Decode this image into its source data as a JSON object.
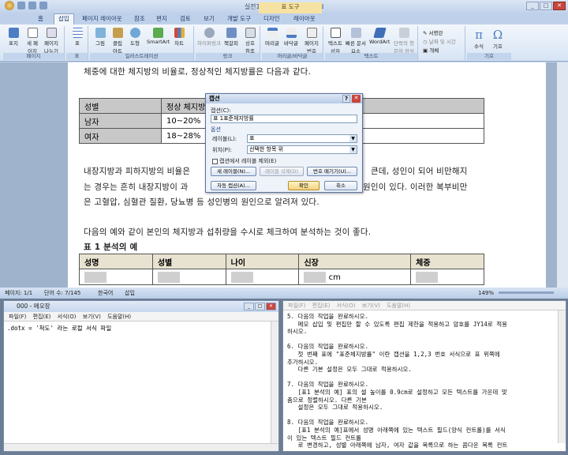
{
  "word": {
    "title": "실전1-06 - Microsoft Word",
    "context_tab_header": "표 도구",
    "tabs": [
      "홈",
      "삽입",
      "페이지 레이아웃",
      "참조",
      "편지",
      "검토",
      "보기",
      "개발 도구",
      "디자인",
      "레이아웃"
    ],
    "active_tab": "삽입",
    "groups": [
      {
        "label": "페이지",
        "buttons": [
          "표지",
          "새 페이지",
          "페이지 나누기"
        ]
      },
      {
        "label": "표",
        "buttons": [
          "표"
        ]
      },
      {
        "label": "일러스트레이션",
        "buttons": [
          "그림",
          "클립 아트",
          "도형",
          "SmartArt",
          "차트"
        ]
      },
      {
        "label": "링크",
        "buttons": [
          "하이퍼링크",
          "책갈피",
          "상호 참조"
        ]
      },
      {
        "label": "머리글/바닥글",
        "buttons": [
          "머리글",
          "바닥글",
          "페이지 번호"
        ]
      },
      {
        "label": "텍스트",
        "buttons": [
          "텍스트 상자",
          "빠른 문서 요소",
          "WordArt",
          "단락의 첫 문자 장식"
        ]
      },
      {
        "label": "",
        "buttons": [
          "서명란",
          "날짜 및 시간",
          "개체"
        ]
      },
      {
        "label": "기호",
        "buttons": [
          "수식",
          "기호"
        ]
      }
    ],
    "doc": {
      "line1": "체중에 대한 체지방의 비율로, 정상적인 체지방률은 다음과 같다.",
      "table1": [
        [
          "성별",
          "정상 체지방률",
          ""
        ],
        [
          "남자",
          "10~20%",
          ""
        ],
        [
          "여자",
          "18~28%",
          ""
        ]
      ],
      "para2_l1": "내장지방과 피하지방의 비율은",
      "para2_l1b": "큰데, 성인이 되어 비만해지",
      "para2_l2": "는 경우는 흔히 내장지방이 과",
      "para2_l2b": "원인이 있다. 이러한 복부비만",
      "para2_l3": "은 고혈압, 심혈관 질환, 당뇨병 등 성인병의 원인으로 알려져 있다.",
      "line3": "다음의 예와 같이 본인의 체지방과 섭취량을 수시로 체크하여 분석하는 것이 좋다.",
      "caption": "표 1 분석의 예",
      "table2_headers": [
        "성명",
        "성별",
        "나이",
        "신장",
        "체중"
      ],
      "table2_unit": "cm"
    },
    "dialog": {
      "title": "캡션",
      "caption_label": "캡션(C):",
      "caption_value": "표 1표준체지방률",
      "options_label": "옵션",
      "label_label": "레이블(L):",
      "label_value": "표",
      "position_label": "위치(P):",
      "position_value": "선택한 항목 위",
      "exclude_label": "캡션에서 레이블 제외(E)",
      "new_label_btn": "새 레이블(N)...",
      "delete_label_btn": "레이블 삭제(D)",
      "numbering_btn": "번호 매기기(U)...",
      "autocaption_btn": "자동 캡션(A)...",
      "ok_btn": "확인",
      "cancel_btn": "취소"
    },
    "status": {
      "page": "페이지: 1/1",
      "words": "단어 수: 7/145",
      "lang": "한국어",
      "mode": "삽입",
      "zoom": "149%"
    }
  },
  "notepad1": {
    "title": "000 - 메모장",
    "menu": [
      "파일(F)",
      "편집(E)",
      "서식(O)",
      "보기(V)",
      "도움말(H)"
    ],
    "body": ".dotx = '척도' 라는 로컬 서식 파일"
  },
  "notepad2": {
    "menu": [
      "파일(F)",
      "편집(E)",
      "서식(O)",
      "보기(V)",
      "도움말(H)"
    ],
    "lines": [
      "5. 다음의 작업을 완료하시오.",
      "   메모 삽입 및 편집만 할 수 있도록 편집 제한을 적용하고 암호를 JY14로 적용",
      "하시오.",
      "",
      "6. 다음의 작업을 완료하시오.",
      "   첫 번째 표에 \"표준체지방률\" 이란 캡션을 1,2,3 번호 서식으로 표 위쪽에",
      "추가하시오.",
      "   다른 기본 설정은 모두 그대로 적용하시오.",
      "",
      "7. 다음의 작업을 완료하시오.",
      "   [표1 분석의 예] 표의 셀 높이를 0.9cm로 설정하고 모든 텍스트를 가운데 맞",
      "춤으로 정렬하시오. 다른 기본",
      "   설정은 모두 그대로 적용하시오.",
      "",
      "8. 다음의 작업을 완료하시오.",
      "   [표1 분석의 예]표에서 성명 아래쪽에 있는 텍스트 필드(양식 컨트롤)를 서식",
      "이 있는 텍스트 필드 컨트롤",
      "   로 변경하고, 성별 아래쪽에 남자, 여자 값을 목록으로 하는 콤다운 목록 컨트"
    ]
  }
}
